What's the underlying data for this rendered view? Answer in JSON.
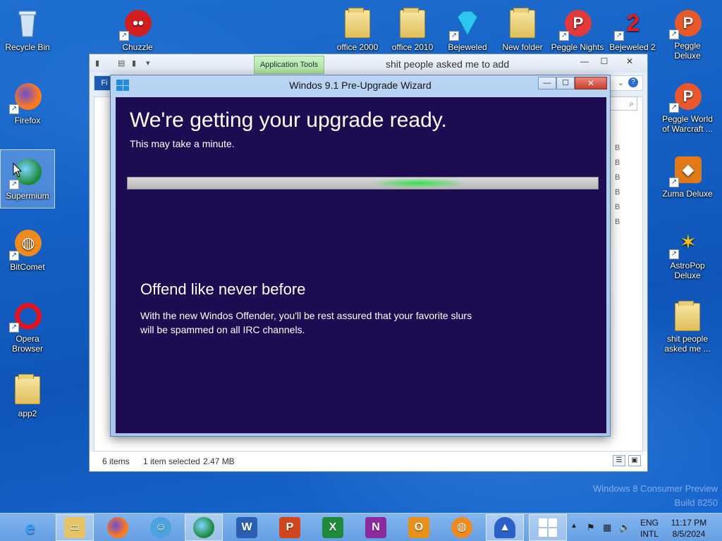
{
  "desktop": {
    "icons": [
      {
        "id": "recycle-bin",
        "label": "Recycle Bin"
      },
      {
        "id": "chuzzle",
        "label": "Chuzzle"
      },
      {
        "id": "office-2000",
        "label": "office 2000"
      },
      {
        "id": "office-2010",
        "label": "office 2010"
      },
      {
        "id": "bejeweled",
        "label": "Bejeweled"
      },
      {
        "id": "new-folder",
        "label": "New folder"
      },
      {
        "id": "peggle-nights",
        "label": "Peggle Nights"
      },
      {
        "id": "bejeweled-2",
        "label": "Bejeweled 2"
      },
      {
        "id": "peggle-deluxe",
        "label": "Peggle Deluxe"
      },
      {
        "id": "firefox",
        "label": "Firefox"
      },
      {
        "id": "supermium",
        "label": "Supermium"
      },
      {
        "id": "bitcomet",
        "label": "BitComet"
      },
      {
        "id": "opera-browser",
        "label": "Opera Browser"
      },
      {
        "id": "app2",
        "label": "app2"
      },
      {
        "id": "peggle-world-of-warcraft",
        "label": "Peggle World of Warcraft ..."
      },
      {
        "id": "zuma-deluxe",
        "label": "Zuma Deluxe"
      },
      {
        "id": "astropop-deluxe",
        "label": "AstroPop Deluxe"
      },
      {
        "id": "shit-people-asked-me",
        "label": "shit people asked me ..."
      }
    ],
    "watermark": {
      "line1": "Windows 8 Consumer Preview",
      "line2": "Build 8250"
    }
  },
  "explorer": {
    "title": "shit people asked me to add",
    "contextual_tab": "Application Tools",
    "file_tab": "Fi",
    "controls": {
      "minimize": "—",
      "maximize": "☐",
      "close": "✕"
    },
    "sizes": [
      "B",
      "B",
      "B",
      "B",
      "B",
      "B"
    ],
    "status": {
      "items": "6 items",
      "selected": "1 item selected",
      "size": "2.47 MB"
    }
  },
  "wizard": {
    "title": "Windos 9.1 Pre-Upgrade Wizard",
    "heading": "We're getting your upgrade ready.",
    "subheading": "This may take a minute.",
    "progress": 0.65,
    "feature_title": "Offend like never before",
    "feature_text": "With the new Windos Offender, you'll be rest assured that your favorite slurs will be spammed on all IRC channels.",
    "controls": {
      "minimize": "—",
      "maximize": "☐",
      "close": "✕"
    }
  },
  "taskbar": {
    "apps": [
      "internet-explorer",
      "file-explorer",
      "firefox",
      "messenger",
      "supermium",
      "word",
      "powerpoint",
      "excel",
      "onenote",
      "outlook",
      "bitcomet",
      "wizard-app",
      "upgrade-wizard"
    ],
    "language": {
      "code": "ENG",
      "layout": "INTL"
    },
    "time": "11:17 PM",
    "date": "8/5/2024"
  },
  "colors": {
    "wizard_bg": "#1e0c52",
    "progress_glow": "#2ee646",
    "taskbar": "#7fb3ea"
  }
}
